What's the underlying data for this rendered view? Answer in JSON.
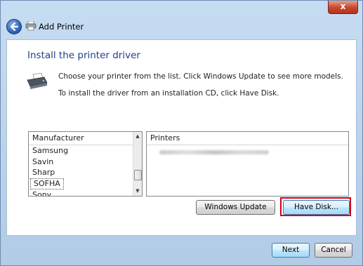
{
  "window": {
    "title": "Add Printer",
    "close_label": "x"
  },
  "content": {
    "heading": "Install the printer driver",
    "description_line1": "Choose your printer from the list. Click Windows Update to see more models.",
    "description_line2": "To install the driver from an installation CD, click Have Disk."
  },
  "manufacturer_list": {
    "header": "Manufacturer",
    "items": [
      "Samsung",
      "Savin",
      "Sharp",
      "SOFHA",
      "Sony"
    ],
    "selected": "SOFHA"
  },
  "printers_list": {
    "header": "Printers",
    "entry_obscured": true
  },
  "buttons": {
    "windows_update": "Windows Update",
    "have_disk": "Have Disk...",
    "next": "Next",
    "cancel": "Cancel"
  },
  "colors": {
    "heading": "#1e3f8a",
    "highlight_border": "#d0021b"
  },
  "icons": {
    "back": "back-arrow-icon",
    "printer": "printer-icon"
  }
}
